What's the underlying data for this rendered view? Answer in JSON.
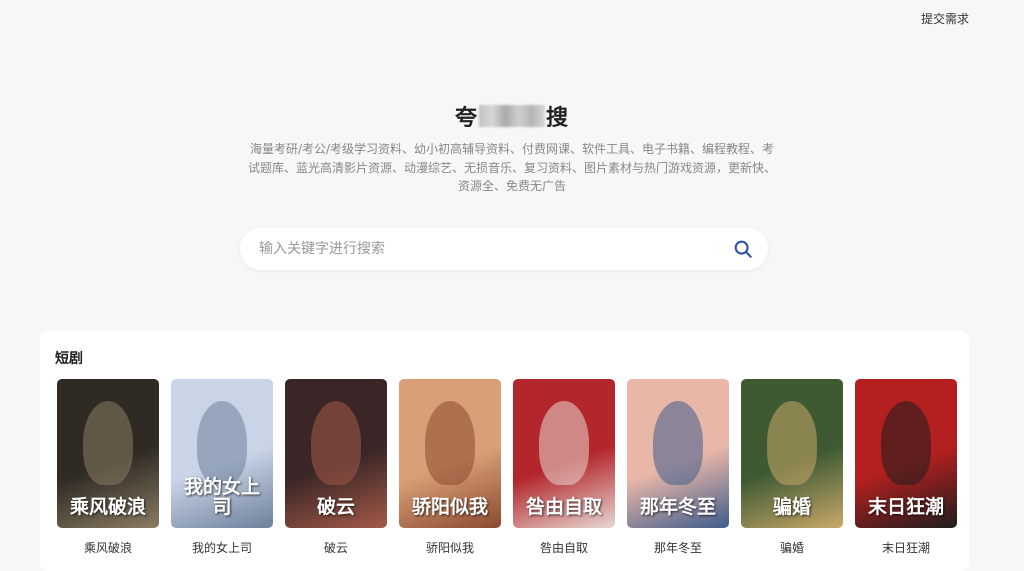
{
  "header": {
    "submit_request_label": "提交需求"
  },
  "hero": {
    "title_start": "夸",
    "title_end": "搜",
    "description": "海量考研/考公/考级学习资料、幼小初高辅导资料、付费网课、软件工具、电子书籍、编程教程、考试题库、蓝光高清影片资源、动漫综艺、无损音乐、复习资料、图片素材与热门游戏资源，更新快、资源全、免费无广告"
  },
  "search": {
    "placeholder": "输入关键字进行搜索",
    "value": ""
  },
  "section": {
    "title": "短剧",
    "items": [
      {
        "label": "乘风破浪",
        "poster_text": "乘风破浪",
        "bg": "#2f2a24",
        "accent": "#8a7b63"
      },
      {
        "label": "我的女上司",
        "poster_text": "我的女上司",
        "bg": "#c9d5e6",
        "accent": "#6d7f9b"
      },
      {
        "label": "破云",
        "poster_text": "破云",
        "bg": "#3a2626",
        "accent": "#a35a48"
      },
      {
        "label": "骄阳似我",
        "poster_text": "骄阳似我",
        "bg": "#d9a077",
        "accent": "#8a4a2f"
      },
      {
        "label": "咎由自取",
        "poster_text": "咎由自取",
        "bg": "#b3262c",
        "accent": "#e7d8d2"
      },
      {
        "label": "那年冬至",
        "poster_text": "那年冬至",
        "bg": "#e8b7a8",
        "accent": "#3f5c8c"
      },
      {
        "label": "骗婚",
        "poster_text": "骗婚",
        "bg": "#3f5a33",
        "accent": "#c9a869"
      },
      {
        "label": "末日狂潮",
        "poster_text": "末日狂潮",
        "bg": "#b41f1f",
        "accent": "#1e1e1e"
      }
    ]
  },
  "colors": {
    "accent": "#2b4fa3",
    "page_bg": "#f7f7f7"
  }
}
